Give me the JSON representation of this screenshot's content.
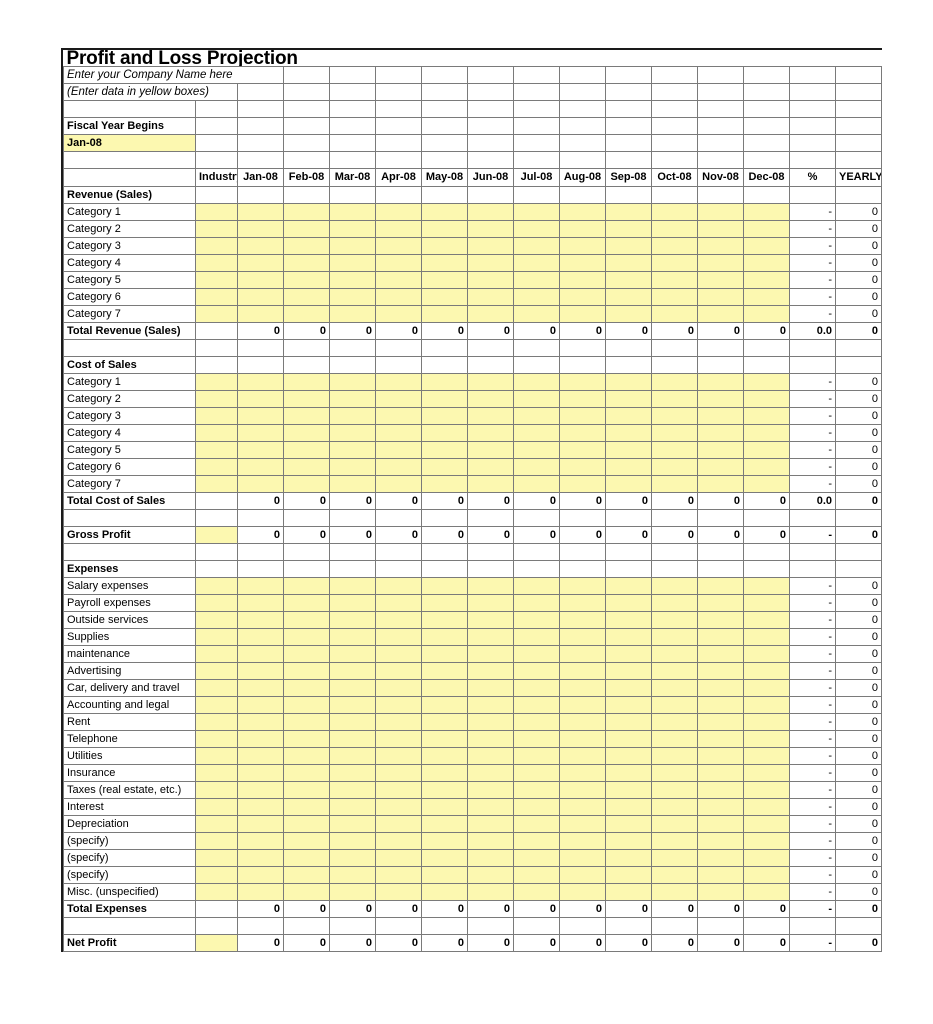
{
  "document": {
    "title": "Profit and Loss Projection",
    "company_placeholder": "Enter your Company Name here",
    "instruction": "(Enter data in yellow boxes)",
    "fiscal_year_label": "Fiscal Year Begins",
    "fiscal_year_value": "Jan-08"
  },
  "colors": {
    "input_cell": "#fcf8b0",
    "grid_line": "#7a7a7a",
    "frame": "#1a1a1a",
    "text": "#000000"
  },
  "columns": {
    "label": "",
    "industry": "Industry",
    "months": [
      "Jan-08",
      "Feb-08",
      "Mar-08",
      "Apr-08",
      "May-08",
      "Jun-08",
      "Jul-08",
      "Aug-08",
      "Sep-08",
      "Oct-08",
      "Nov-08",
      "Dec-08"
    ],
    "percent": "%",
    "yearly": "YEARLY"
  },
  "sections": {
    "revenue": {
      "heading": "Revenue (Sales)",
      "categories": [
        "Category 1",
        "Category 2",
        "Category 3",
        "Category 4",
        "Category 5",
        "Category 6",
        "Category 7"
      ],
      "total_label": "Total Revenue (Sales)",
      "total_months": [
        "0",
        "0",
        "0",
        "0",
        "0",
        "0",
        "0",
        "0",
        "0",
        "0",
        "0",
        "0"
      ],
      "total_percent": "0.0",
      "total_yearly": "0"
    },
    "cost_of_sales": {
      "heading": "Cost of Sales",
      "categories": [
        "Category 1",
        "Category 2",
        "Category 3",
        "Category 4",
        "Category 5",
        "Category 6",
        "Category 7"
      ],
      "total_label": "Total Cost of Sales",
      "total_months": [
        "0",
        "0",
        "0",
        "0",
        "0",
        "0",
        "0",
        "0",
        "0",
        "0",
        "0",
        "0"
      ],
      "total_percent": "0.0",
      "total_yearly": "0"
    },
    "gross_profit": {
      "label": "Gross Profit",
      "months": [
        "0",
        "0",
        "0",
        "0",
        "0",
        "0",
        "0",
        "0",
        "0",
        "0",
        "0",
        "0"
      ],
      "percent": "-",
      "yearly": "0"
    },
    "expenses": {
      "heading": "Expenses",
      "items": [
        "Salary expenses",
        "Payroll expenses",
        "Outside services",
        "Supplies",
        "maintenance",
        "Advertising",
        "Car, delivery and travel",
        "Accounting and legal",
        "Rent",
        "Telephone",
        "Utilities",
        "Insurance",
        "Taxes (real estate, etc.)",
        "Interest",
        "Depreciation",
        "(specify)",
        "(specify)",
        "(specify)",
        "Misc. (unspecified)"
      ],
      "total_label": "Total Expenses",
      "total_months": [
        "0",
        "0",
        "0",
        "0",
        "0",
        "0",
        "0",
        "0",
        "0",
        "0",
        "0",
        "0"
      ],
      "total_percent": "-",
      "total_yearly": "0"
    },
    "net_profit": {
      "label": "Net Profit",
      "months": [
        "0",
        "0",
        "0",
        "0",
        "0",
        "0",
        "0",
        "0",
        "0",
        "0",
        "0",
        "0"
      ],
      "percent": "-",
      "yearly": "0"
    }
  },
  "item_row_percent": "-",
  "item_row_yearly": "0"
}
